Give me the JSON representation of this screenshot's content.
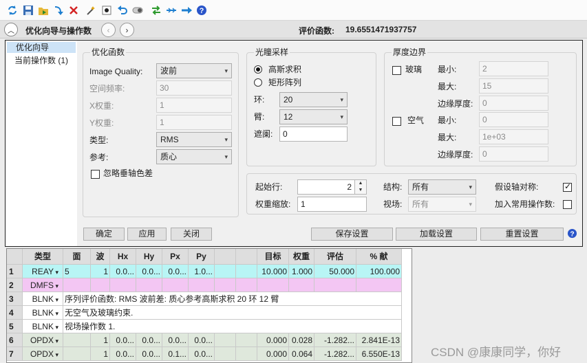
{
  "toolbar": {
    "icons": [
      "refresh-icon",
      "save-icon",
      "load-icon",
      "arrow-down-icon",
      "delete-icon",
      "wizard-icon",
      "record-icon",
      "undo-icon",
      "toggle-icon",
      "swap-icon",
      "insert-icon",
      "next-icon",
      "help-icon"
    ]
  },
  "titlebar": {
    "title": "优化向导与操作数",
    "merit_label": "评价函数:",
    "merit_value": "19.6551471937757"
  },
  "leftnav": {
    "items": [
      {
        "label": "优化向导",
        "selected": true
      },
      {
        "label": "当前操作数 (1)",
        "selected": false
      }
    ]
  },
  "optfunc": {
    "title": "优化函数",
    "image_quality_label": "Image Quality:",
    "image_quality_value": "波前",
    "spatial_freq_label": "空间频率:",
    "spatial_freq_value": "30",
    "xweight_label": "X权重:",
    "xweight_value": "1",
    "yweight_label": "Y权重:",
    "yweight_value": "1",
    "type_label": "类型:",
    "type_value": "RMS",
    "ref_label": "参考:",
    "ref_value": "质心",
    "ignore_label": "忽略垂轴色差",
    "ignore_checked": false
  },
  "pupil": {
    "title": "光瞳采样",
    "gauss_label": "高斯求积",
    "gauss_selected": true,
    "rect_label": "矩形阵列",
    "rings_label": "环:",
    "rings_value": "20",
    "arms_label": "臂:",
    "arms_value": "12",
    "obsc_label": "遮阑:",
    "obsc_value": "0"
  },
  "thickness": {
    "title": "厚度边界",
    "glass_label": "玻璃",
    "glass_checked": false,
    "glass_min_label": "最小:",
    "glass_min_value": "2",
    "glass_max_label": "最大:",
    "glass_max_value": "15",
    "glass_edge_label": "边缘厚度:",
    "glass_edge_value": "0",
    "air_label": "空气",
    "air_checked": false,
    "air_min_label": "最小:",
    "air_min_value": "0",
    "air_max_label": "最大:",
    "air_max_value": "1e+03",
    "air_edge_label": "边缘厚度:",
    "air_edge_value": "0"
  },
  "misc": {
    "start_row_label": "起始行:",
    "start_row_value": "2",
    "weight_scale_label": "权重缩放:",
    "weight_scale_value": "1",
    "config_label": "结构:",
    "config_value": "所有",
    "field_label": "视场:",
    "field_value": "所有",
    "axial_label": "假设轴对称:",
    "axial_checked": true,
    "common_label": "加入常用操作数:",
    "common_checked": false
  },
  "buttons": {
    "ok": "确定",
    "apply": "应用",
    "close": "关闭",
    "save": "保存设置",
    "load": "加载设置",
    "reset": "重置设置"
  },
  "table": {
    "headers": [
      "类型",
      "面",
      "波",
      "Hx",
      "Hy",
      "Px",
      "Py",
      "",
      "",
      "目标",
      "权重",
      "评估",
      "% 献"
    ],
    "rows": [
      {
        "n": "1",
        "type": "REAY",
        "cells": [
          "5",
          "1",
          "0.0...",
          "0.0...",
          "0.0...",
          "1.0...",
          "",
          "",
          "10.000",
          "1.000",
          "50.000",
          "100.000"
        ],
        "color": "#b8f5f5"
      },
      {
        "n": "2",
        "type": "DMFS",
        "cells": [],
        "color": "#f3c6f3"
      },
      {
        "n": "3",
        "type": "BLNK",
        "comment": "序列评价函数: RMS 波前差: 质心参考高斯求积 20 环 12 臂",
        "color": "#ffffff"
      },
      {
        "n": "4",
        "type": "BLNK",
        "comment": "无空气及玻璃约束.",
        "color": "#ffffff"
      },
      {
        "n": "5",
        "type": "BLNK",
        "comment": "视场操作数 1.",
        "color": "#ffffff"
      },
      {
        "n": "6",
        "type": "OPDX",
        "cells": [
          "",
          "1",
          "0.0...",
          "0.0...",
          "0.0...",
          "0.0...",
          "",
          "",
          "0.000",
          "0.028",
          "-1.282...",
          "2.841E-13"
        ],
        "color": "#dfe8dc"
      },
      {
        "n": "7",
        "type": "OPDX",
        "cells": [
          "",
          "1",
          "0.0...",
          "0.0...",
          "0.1...",
          "0.0...",
          "",
          "",
          "0.000",
          "0.064",
          "-1.282...",
          "6.550E-13"
        ],
        "color": "#dfe8dc"
      }
    ]
  },
  "watermark": "CSDN @康康同学，你好"
}
